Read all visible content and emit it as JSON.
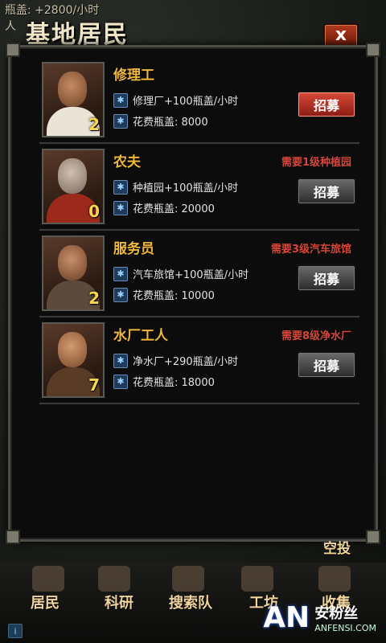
{
  "hud": {
    "line1": "瓶盖: +2800/小时",
    "line2": "人"
  },
  "window": {
    "title": "基地居民",
    "close_label": "x"
  },
  "residents": [
    {
      "name": "修理工",
      "count": "2",
      "requirement": "",
      "bonus": "修理厂+100瓶盖/小时",
      "cost": "花费瓶盖: 8000",
      "button": "招募",
      "button_state": "red"
    },
    {
      "name": "农夫",
      "count": "0",
      "requirement": "需要1级种植园",
      "bonus": "种植园+100瓶盖/小时",
      "cost": "花费瓶盖: 20000",
      "button": "招募",
      "button_state": "gray"
    },
    {
      "name": "服务员",
      "count": "2",
      "requirement": "需要3级汽车旅馆",
      "bonus": "汽车旅馆+100瓶盖/小时",
      "cost": "花费瓶盖: 10000",
      "button": "招募",
      "button_state": "gray"
    },
    {
      "name": "水厂工人",
      "count": "7",
      "requirement": "需要8级净水厂",
      "bonus": "净水厂+290瓶盖/小时",
      "cost": "花费瓶盖: 18000",
      "button": "招募",
      "button_state": "gray"
    }
  ],
  "drop_label": "空投",
  "tabs": [
    "居民",
    "科研",
    "搜索队",
    "工坊",
    "收集"
  ],
  "watermark": {
    "logo": "AN",
    "name": "安粉丝",
    "domain": "ANFENSI.COM"
  }
}
